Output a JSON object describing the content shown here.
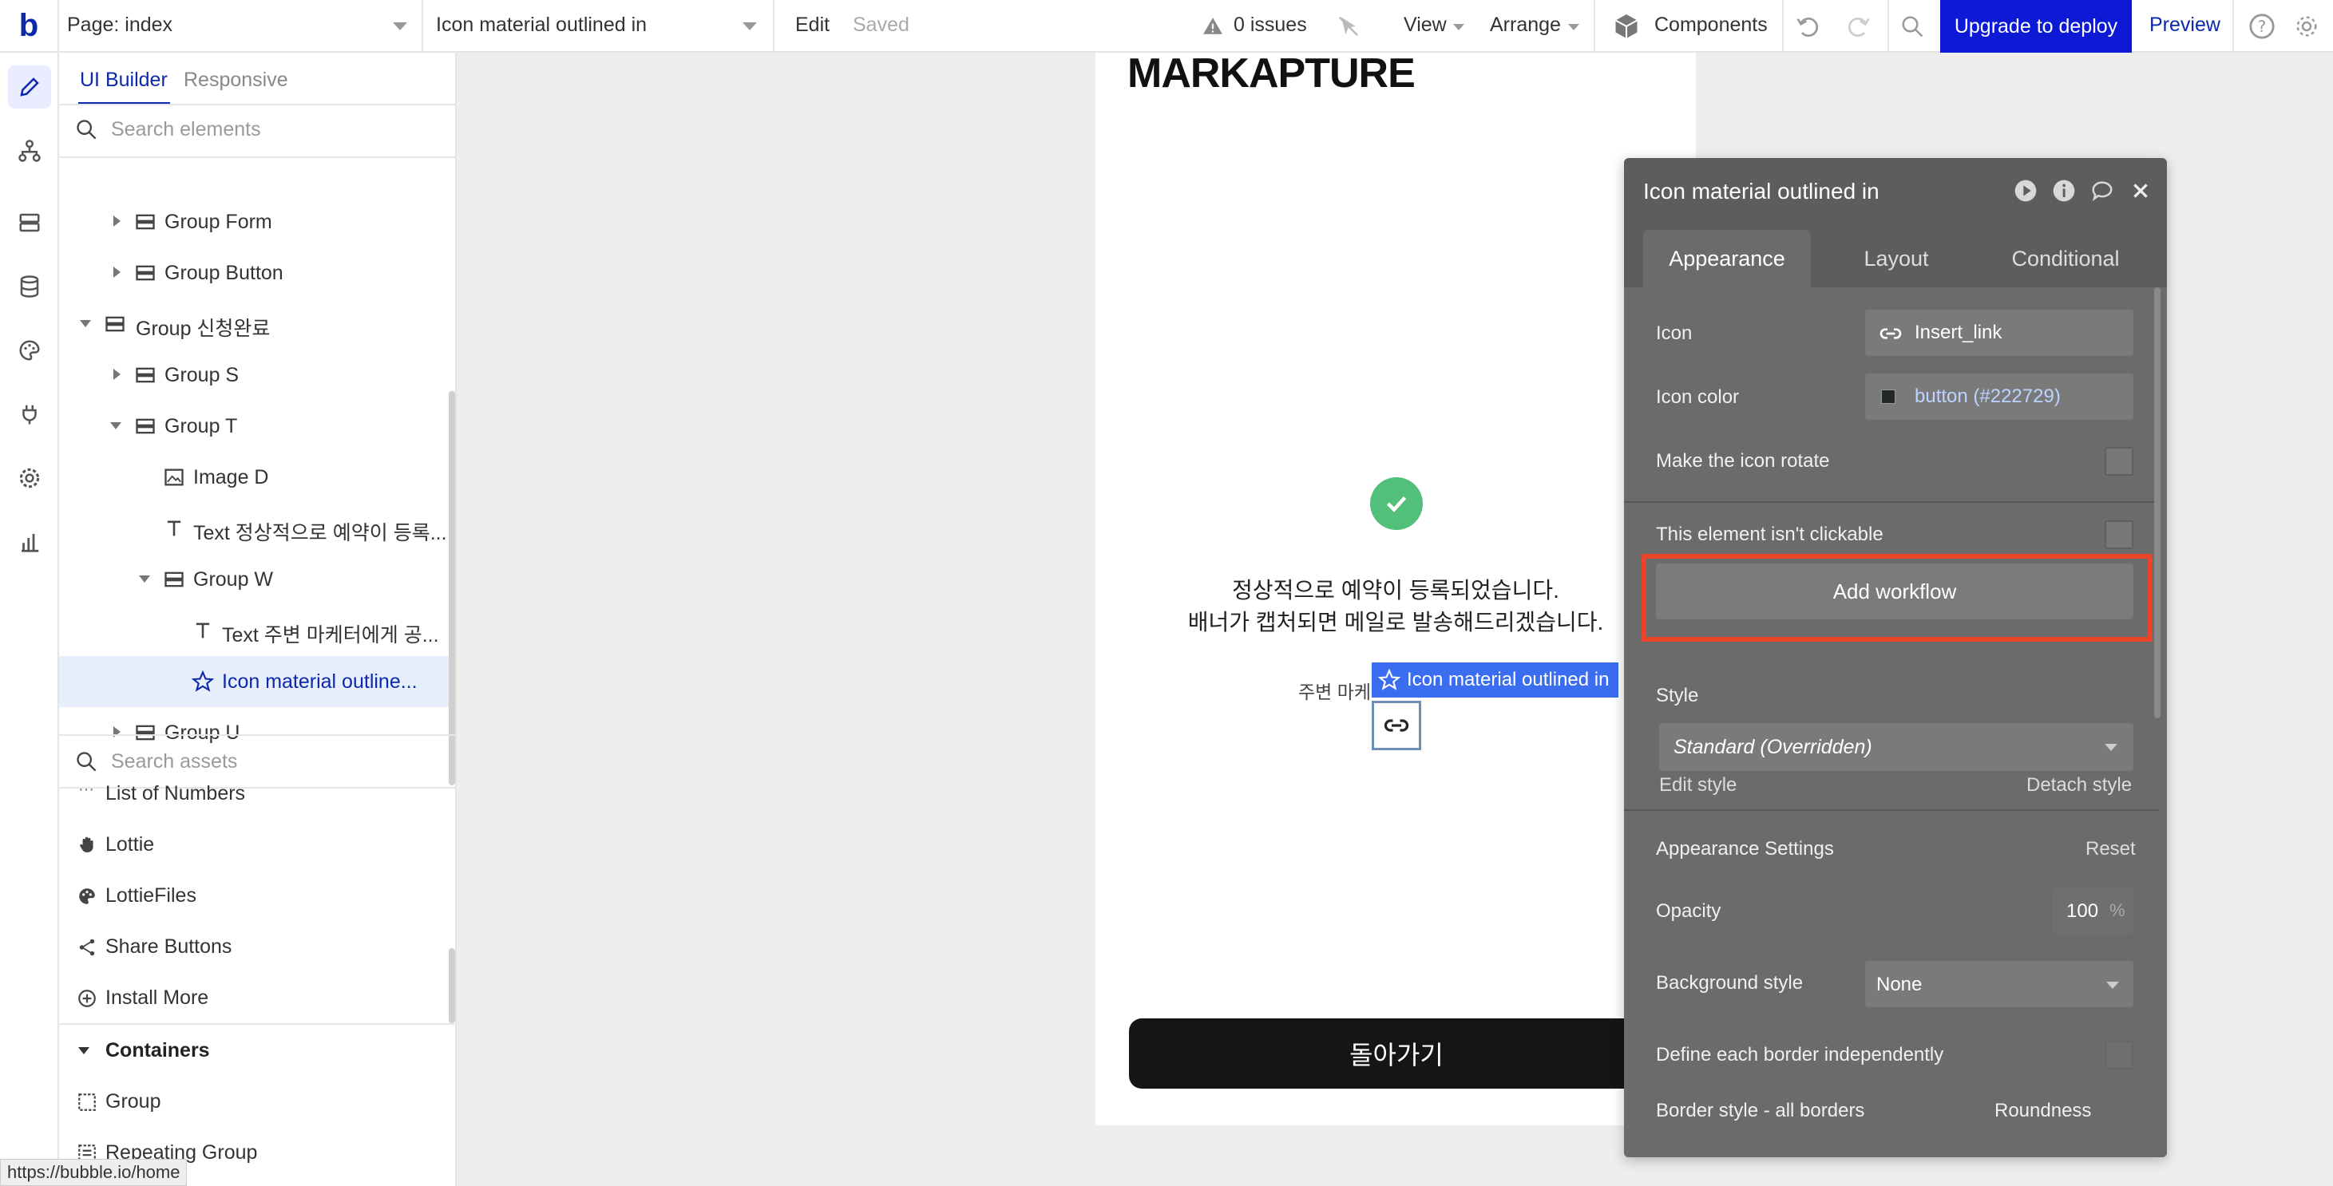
{
  "topbar": {
    "logo": "b",
    "page_selector": "Page: index",
    "element_selector": "Icon material outlined in",
    "edit_label": "Edit",
    "saved_label": "Saved",
    "issues_label": "0 issues",
    "view_label": "View",
    "arrange_label": "Arrange",
    "components_label": "Components",
    "upgrade_label": "Upgrade to deploy",
    "preview_label": "Preview"
  },
  "left_panel": {
    "tabs": [
      "UI Builder",
      "Responsive"
    ],
    "search_elements_placeholder": "Search elements",
    "tree": [
      {
        "label": "Group Form"
      },
      {
        "label": "Group Button"
      },
      {
        "label": "Group 신청완료"
      },
      {
        "label": "Group S"
      },
      {
        "label": "Group T"
      },
      {
        "label": "Image D"
      },
      {
        "label": "Text 정상적으로 예약이 등록..."
      },
      {
        "label": "Group W"
      },
      {
        "label": "Text 주변 마케터에게 공..."
      },
      {
        "label": "Icon material outline..."
      },
      {
        "label": "Group U"
      }
    ],
    "search_assets_placeholder": "Search assets",
    "assets": [
      {
        "label": "List of Numbers"
      },
      {
        "label": "Lottie"
      },
      {
        "label": "LottieFiles"
      },
      {
        "label": "Share Buttons"
      },
      {
        "label": "Install More"
      }
    ],
    "containers_header": "Containers",
    "containers": [
      {
        "label": "Group"
      },
      {
        "label": "Repeating Group"
      }
    ]
  },
  "canvas": {
    "brand": "MARKAPTURE",
    "message_line1": "정상적으로 예약이 등록되었습니다.",
    "message_line2": "배너가 캡처되면 메일로 발송해드리겠습니다.",
    "small_text": "주변 마케",
    "selected_label": "Icon material outlined in",
    "back_button": "돌아가기"
  },
  "editor": {
    "title": "Icon material outlined in",
    "tabs": [
      "Appearance",
      "Layout",
      "Conditional"
    ],
    "icon_label": "Icon",
    "icon_value": "Insert_link",
    "icon_color_label": "Icon color",
    "icon_color_value": "button (#222729)",
    "rotate_label": "Make the icon rotate",
    "not_clickable_label": "This element isn't clickable",
    "add_workflow": "Add workflow",
    "style_label": "Style",
    "style_value": "Standard (Overridden)",
    "edit_style": "Edit style",
    "detach_style": "Detach style",
    "appearance_settings": "Appearance Settings",
    "reset": "Reset",
    "opacity_label": "Opacity",
    "opacity_value": "100",
    "opacity_unit": "%",
    "background_style_label": "Background style",
    "background_style_value": "None",
    "define_borders_label": "Define each border independently",
    "border_style_label": "Border style - all borders",
    "roundness_label": "Roundness"
  },
  "status_bar": {
    "url": "https://bubble.io/home"
  },
  "colors": {
    "brand_blue": "#0c29ab",
    "upgrade_blue": "#0c1ad6",
    "highlight_red": "#e8442a",
    "check_green": "#52c07a",
    "icon_color_swatch": "#222729"
  }
}
